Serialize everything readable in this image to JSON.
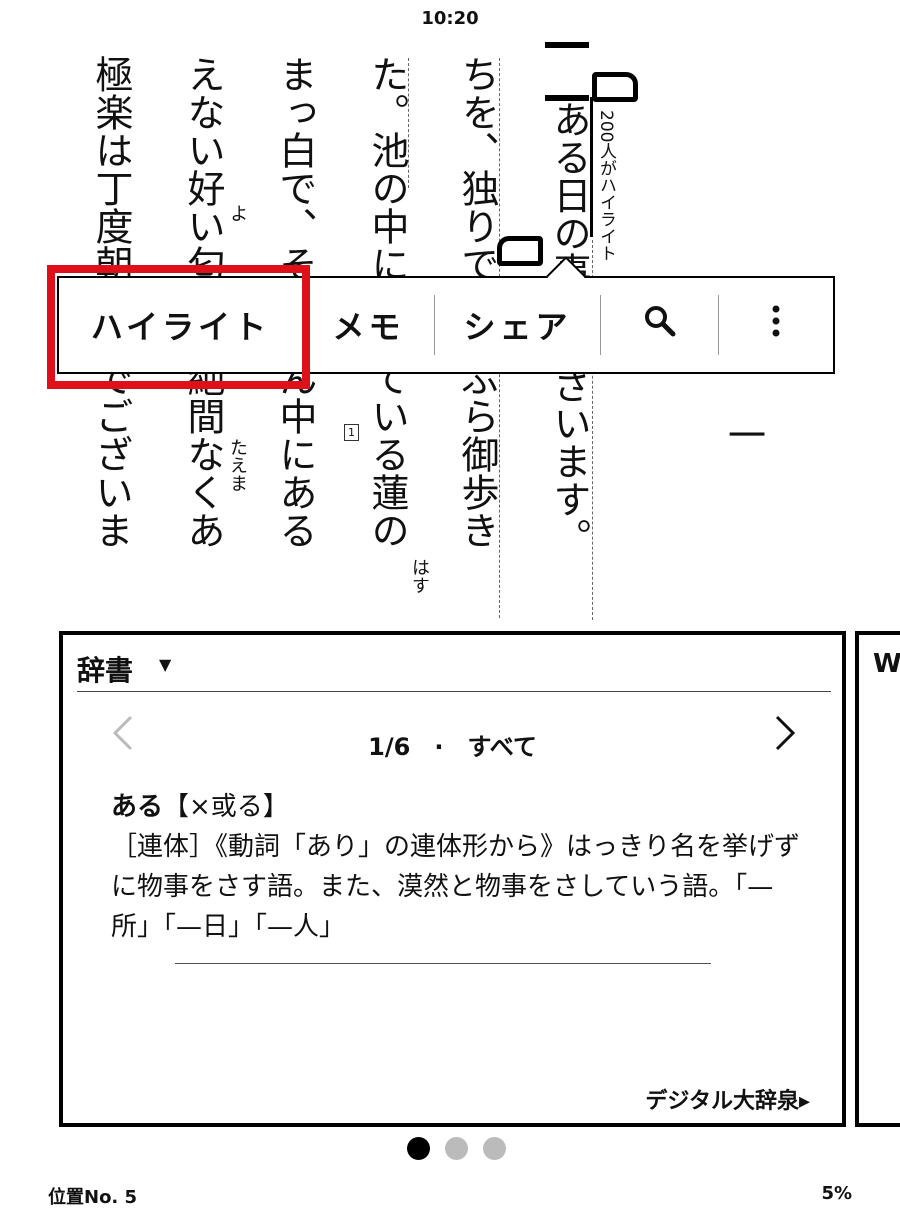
{
  "status": {
    "time": "10:20"
  },
  "book": {
    "columns": [
      "極楽は丁度朝なのでございま",
      "えない好い匂が、絶間なくあ",
      "まっ白で、そのまん中にある",
      "た。池の中に咲いている蓮の",
      "ちを、独りでぶらぶら御歩き",
      "ある日の事でございます。"
    ],
    "ruby": [
      "よ",
      "たえま",
      "はす"
    ],
    "side_note": "200人がハイライト",
    "note_marker": "1",
    "chapter": "一",
    "top_mark": "二"
  },
  "popup": {
    "items": [
      "ハイライト",
      "メモ",
      "シェア"
    ],
    "search_icon": "search-icon",
    "more_icon": "more-vertical-icon"
  },
  "dictionary": {
    "title": "辞書",
    "caret": "▼",
    "pager": "1/6　·　すべて",
    "headword": "ある",
    "kanji": "【×或る】",
    "definition": "［連体］《動詞「あり」の連体形から》はっきり名を挙げずに物事をさす語。また、漠然と物事をさしていう語。「—所」「—日」「—人」",
    "source": "デジタル大辞泉▸",
    "next_card_title": "W"
  },
  "footer": {
    "location": "位置No. 5",
    "percent": "5%"
  }
}
